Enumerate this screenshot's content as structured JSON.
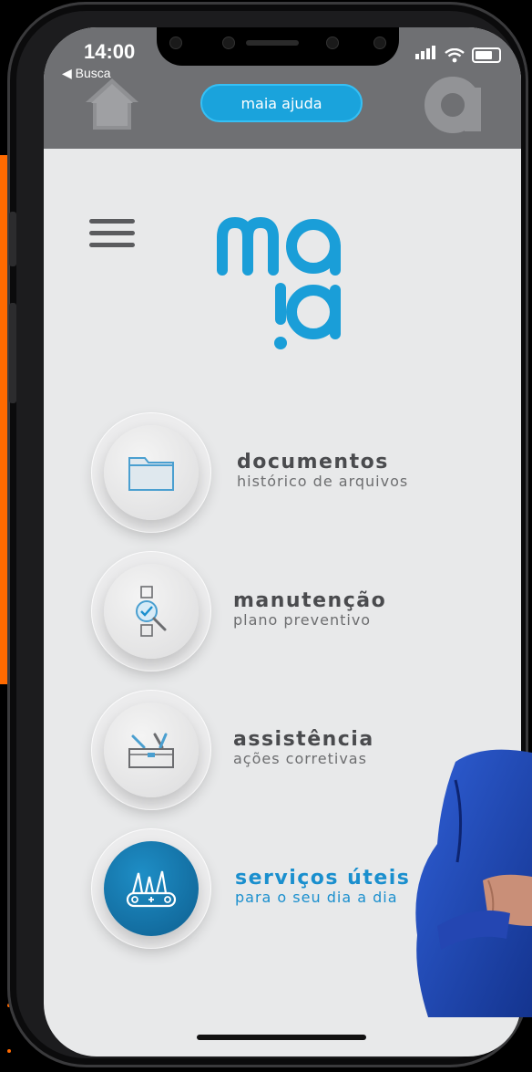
{
  "status_bar": {
    "time": "14:00",
    "back_label": "◀ Busca"
  },
  "header": {
    "help_button_label": "maia ajuda",
    "home_icon": "home-icon",
    "profile_icon": "profile-icon"
  },
  "logo": {
    "text": "maia"
  },
  "menu": {
    "items": [
      {
        "title": "documentos",
        "subtitle": "histórico de arquivos",
        "icon": "folder-icon"
      },
      {
        "title": "manutenção",
        "subtitle": "plano preventivo",
        "icon": "checklist-magnifier-icon"
      },
      {
        "title": "assistência",
        "subtitle": "ações corretivas",
        "icon": "toolbox-icon"
      },
      {
        "title": "serviços úteis",
        "subtitle": "para o seu dia a dia",
        "icon": "multitool-icon"
      }
    ]
  },
  "colors": {
    "accent": "#1a8fce",
    "header": "#6f7073",
    "screen_bg": "#e8e9ea",
    "backdrop_stripe": "#ff6a00"
  }
}
